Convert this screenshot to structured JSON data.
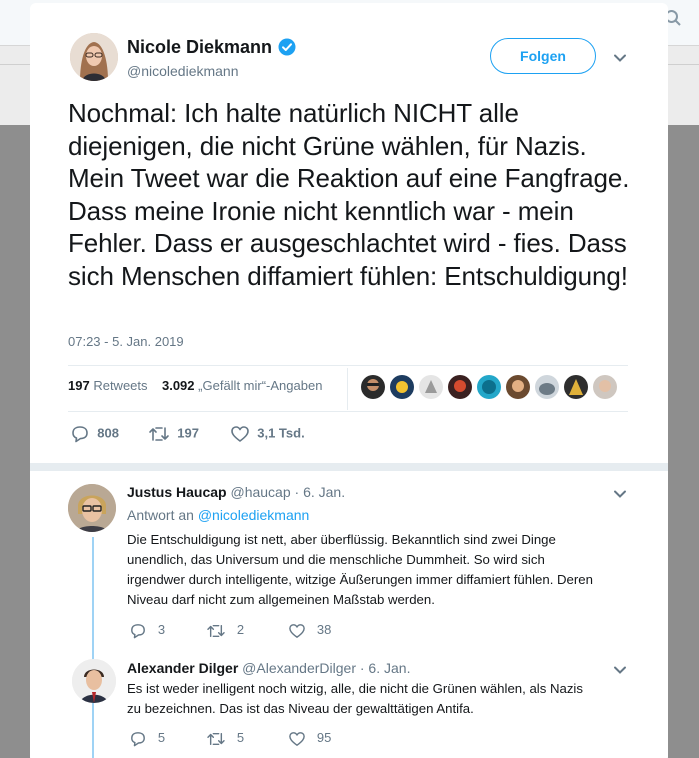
{
  "background": {
    "search_icon": "search-icon"
  },
  "tweet": {
    "author_name": "Nicole Diekmann",
    "author_handle": "@nicolediekmann",
    "follow_label": "Folgen",
    "text": "Nochmal: Ich halte natürlich NICHT alle diejenigen, die nicht Grüne wählen, für Nazis. Mein Tweet war die Reaktion auf eine Fangfrage. Dass meine Ironie nicht kenntlich war - mein Fehler. Dass er ausgeschlachtet wird - fies. Dass sich Menschen diffamiert fühlen: Entschuldigung!",
    "timestamp": "07:23 - 5. Jan. 2019",
    "retweets_count": "197",
    "retweets_label": "Retweets",
    "likes_count": "3.092",
    "likes_label": "„Gefällt mir“-Angaben",
    "actions": {
      "replies": "808",
      "retweets": "197",
      "likes": "3,1 Tsd."
    }
  },
  "replies": [
    {
      "name": "Justus Haucap",
      "handle": "@haucap",
      "date": "· 6. Jan.",
      "reply_to_label": "Antwort an",
      "reply_to_handle": "@nicolediekmann",
      "text": "Die Entschuldigung ist nett, aber überflüssig. Bekanntlich sind zwei Dinge unendlich, das Universum und die menschliche Dummheit. So wird sich irgendwer durch intelligente, witzige Äußerungen immer diffamiert fühlen. Deren Niveau darf nicht zum allgemeinen Maßstab werden.",
      "replies": "3",
      "retweets": "2",
      "likes": "38"
    },
    {
      "name": "Alexander Dilger",
      "handle": "@AlexanderDilger",
      "date": "· 6. Jan.",
      "text": "Es ist weder inelligent noch witzig, alle, die nicht die Grünen wählen, als Nazis zu bezeichnen. Das ist das Niveau der gewalttätigen Antifa.",
      "replies": "5",
      "retweets": "5",
      "likes": "95"
    }
  ],
  "colors": {
    "accent": "#1da1f2",
    "muted": "#657786",
    "thread": "#9fd3f5"
  }
}
